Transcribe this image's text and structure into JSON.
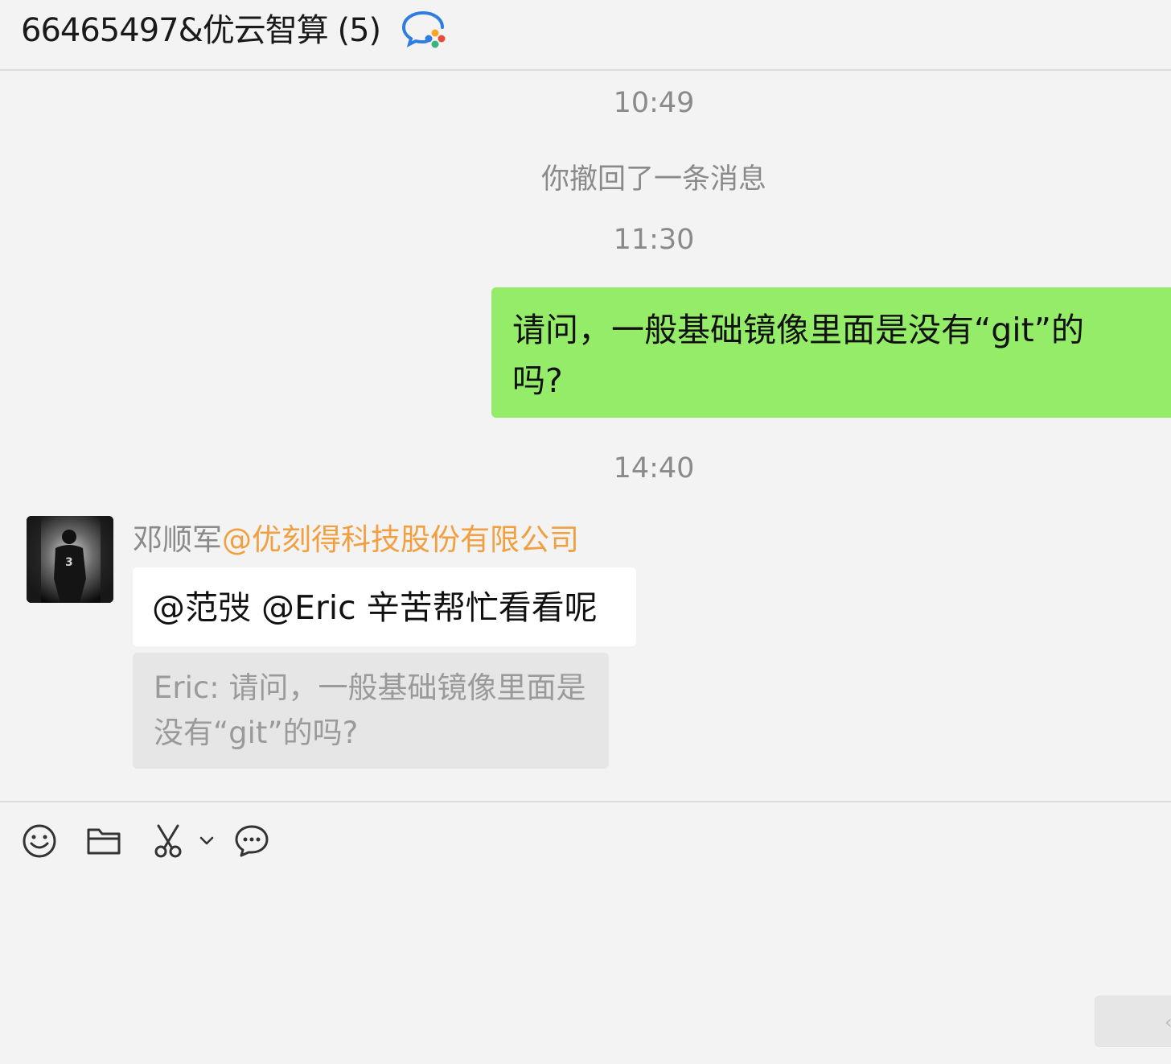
{
  "header": {
    "title": "66465497&优云智算 (5)",
    "icon": "wecom-chat-icon"
  },
  "messages": {
    "time1": "10:49",
    "recall_notice": "你撤回了一条消息",
    "time2": "11:30",
    "self_message": {
      "line1": "请问，一般基础镜像里面是没有“git”的",
      "line2": "吗?"
    },
    "time3": "14:40",
    "other_message": {
      "sender_name": "邓顺军",
      "sender_org": "@优刻得科技股份有限公司",
      "text": "@范弢 @Eric 辛苦帮忙看看呢",
      "quote": {
        "line1": "Eric: 请问，一般基础镜像里面是",
        "line2": "没有“git”的吗?"
      }
    }
  },
  "toolbar": {
    "icons": [
      "emoji-icon",
      "folder-icon",
      "scissors-icon",
      "chevron-down-icon",
      "chat-bubble-icon"
    ]
  },
  "send_button": {
    "label": "‹"
  }
}
